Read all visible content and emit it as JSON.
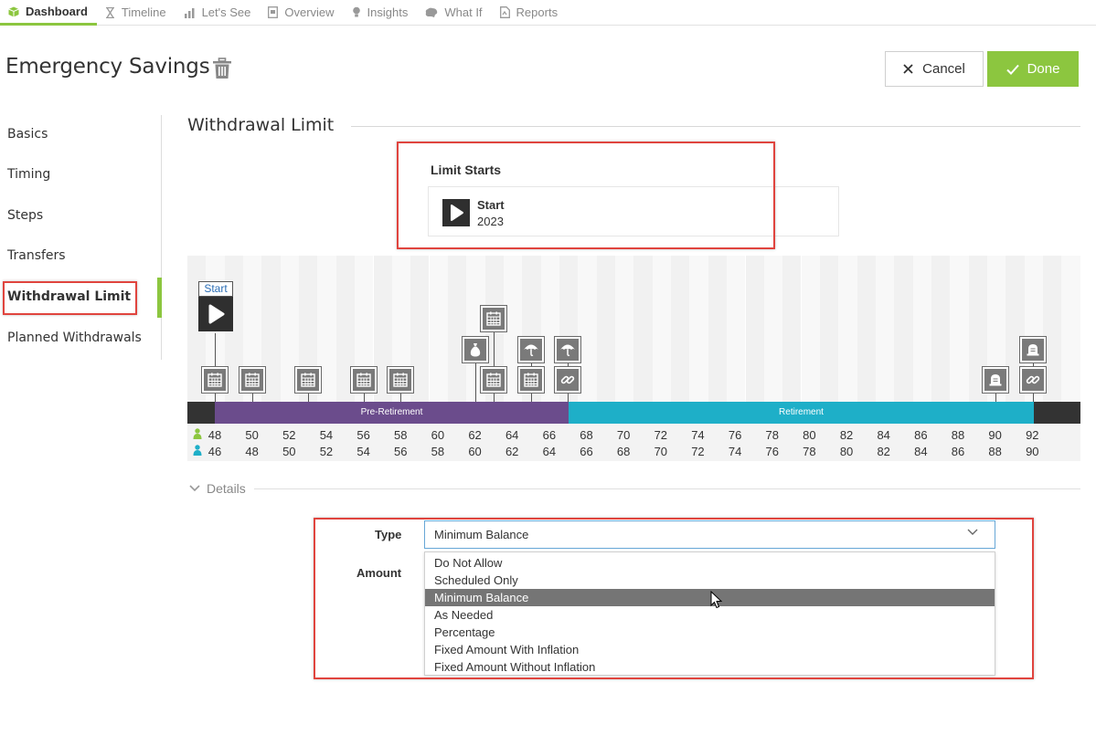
{
  "nav": {
    "tabs": [
      {
        "label": "Dashboard",
        "icon": "cube-icon",
        "active": true
      },
      {
        "label": "Timeline",
        "icon": "hourglass-icon"
      },
      {
        "label": "Let's See",
        "icon": "bar-chart-icon"
      },
      {
        "label": "Overview",
        "icon": "document-icon"
      },
      {
        "label": "Insights",
        "icon": "lightbulb-icon"
      },
      {
        "label": "What If",
        "icon": "brain-icon"
      },
      {
        "label": "Reports",
        "icon": "report-icon"
      }
    ]
  },
  "header": {
    "title": "Emergency Savings",
    "cancel_label": "Cancel",
    "done_label": "Done"
  },
  "sidebar": {
    "items": [
      {
        "label": "Basics"
      },
      {
        "label": "Timing"
      },
      {
        "label": "Steps"
      },
      {
        "label": "Transfers"
      },
      {
        "label": "Withdrawal Limit",
        "active": true
      },
      {
        "label": "Planned Withdrawals"
      }
    ]
  },
  "section": {
    "title": "Withdrawal Limit",
    "limit_starts_label": "Limit Starts",
    "start_card": {
      "title": "Start",
      "year": "2023"
    }
  },
  "timeline": {
    "start_marker_label": "Start",
    "pre_retirement_label": "Pre-Retirement",
    "retirement_label": "Retirement",
    "ages_person1": [
      "48",
      "50",
      "52",
      "54",
      "56",
      "58",
      "60",
      "62",
      "64",
      "66",
      "68",
      "70",
      "72",
      "74",
      "76",
      "78",
      "80",
      "82",
      "84",
      "86",
      "88",
      "90",
      "92"
    ],
    "ages_person2": [
      "46",
      "48",
      "50",
      "52",
      "54",
      "56",
      "58",
      "60",
      "62",
      "64",
      "66",
      "68",
      "70",
      "72",
      "74",
      "76",
      "78",
      "80",
      "82",
      "84",
      "86",
      "88",
      "90"
    ],
    "colors": {
      "pre_retirement": "#6b4c8c",
      "retirement": "#1eafc8",
      "person1": "#8cc63f",
      "person2": "#1eafc8"
    }
  },
  "details": {
    "toggle_label": "Details",
    "type_label": "Type",
    "amount_label": "Amount",
    "type_value": "Minimum Balance",
    "options": [
      "Do Not Allow",
      "Scheduled Only",
      "Minimum Balance",
      "As Needed",
      "Percentage",
      "Fixed Amount With Inflation",
      "Fixed Amount Without Inflation"
    ],
    "selected_index": 2
  },
  "theme": {
    "accent": "#8cc63f",
    "highlight": "#e0443e"
  }
}
